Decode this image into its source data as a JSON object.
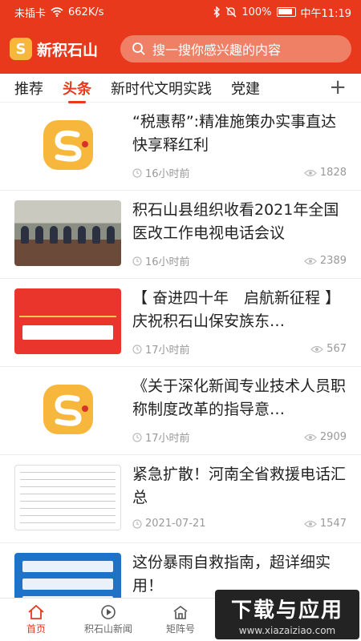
{
  "status_bar": {
    "carrier": "未插卡",
    "speed": "662K/s",
    "battery": "100%",
    "time": "中午11:19"
  },
  "app": {
    "name": "新积石山",
    "logo_glyph": "S",
    "search_placeholder": "搜一搜你感兴趣的内容"
  },
  "tabs": {
    "items": [
      "推荐",
      "头条",
      "新时代文明实践",
      "党建"
    ],
    "active": "头条",
    "add": "+"
  },
  "feed": [
    {
      "title": "“税惠帮”:精准施策办实事直达快享释红利",
      "time": "16小时前",
      "views": "1828",
      "thumb": "logo"
    },
    {
      "title": "积石山县组织收看2021年全国医改工作电视电话会议",
      "time": "16小时前",
      "views": "2389",
      "thumb": "meeting"
    },
    {
      "title": "【 奋进四十年　启航新征程 】庆祝积石山保安族东…",
      "time": "17小时前",
      "views": "567",
      "thumb": "banner"
    },
    {
      "title": "《关于深化新闻专业技术人员职称制度改革的指导意…",
      "time": "17小时前",
      "views": "2909",
      "thumb": "logo"
    },
    {
      "title": "紧急扩散！河南全省救援电话汇总",
      "time": "2021-07-21",
      "views": "1547",
      "thumb": "table"
    },
    {
      "title": "这份暴雨自救指南，超详细实用！",
      "time": "",
      "views": "",
      "thumb": "blue"
    }
  ],
  "bottom_nav": {
    "items": [
      "首页",
      "积石山新闻",
      "矩阵号"
    ],
    "active": "首页"
  },
  "watermark": {
    "text": "下载与应用",
    "url": "www.xiazaiziao.com"
  },
  "colors": {
    "brand": "#e8391d",
    "logo_yellow": "#f6b73c"
  },
  "icons": [
    "search-icon",
    "clock-icon",
    "eye-icon",
    "home-icon",
    "play-icon",
    "building-icon",
    "wifi-icon",
    "bluetooth-icon",
    "mute-icon",
    "battery-icon"
  ]
}
